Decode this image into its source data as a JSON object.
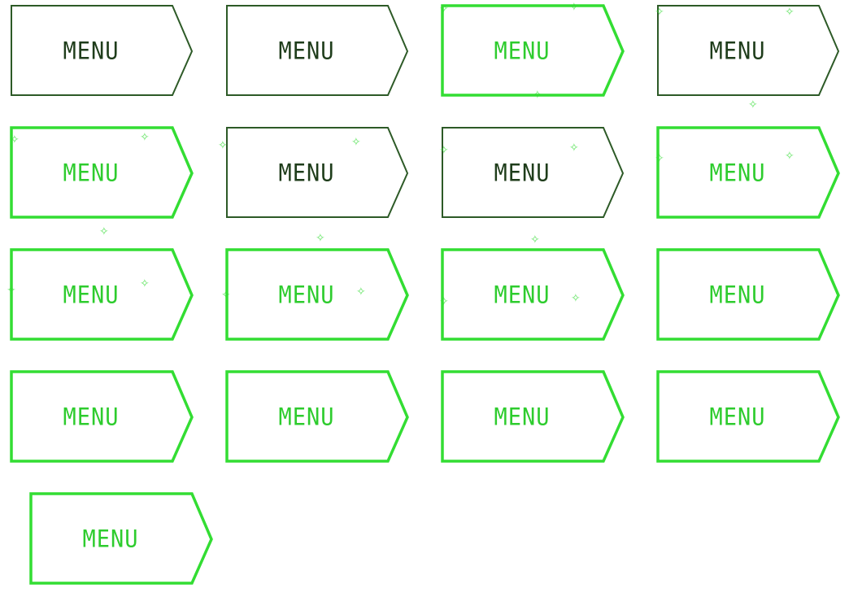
{
  "palette": {
    "dark": "#2d5a27",
    "dark_text": "#1f3d1b",
    "bright": "#33dd33",
    "bright_text": "#2ecc2e"
  },
  "buttons": [
    {
      "label": "MENU",
      "style": "dark"
    },
    {
      "label": "MENU",
      "style": "dark"
    },
    {
      "label": "MENU",
      "style": "bright"
    },
    {
      "label": "MENU",
      "style": "dark"
    },
    {
      "label": "MENU",
      "style": "bright"
    },
    {
      "label": "MENU",
      "style": "dark"
    },
    {
      "label": "MENU",
      "style": "dark"
    },
    {
      "label": "MENU",
      "style": "bright"
    },
    {
      "label": "MENU",
      "style": "bright"
    },
    {
      "label": "MENU",
      "style": "bright"
    },
    {
      "label": "MENU",
      "style": "bright"
    },
    {
      "label": "MENU",
      "style": "bright"
    },
    {
      "label": "MENU",
      "style": "bright"
    },
    {
      "label": "MENU",
      "style": "bright"
    },
    {
      "label": "MENU",
      "style": "bright"
    },
    {
      "label": "MENU",
      "style": "bright"
    },
    {
      "label": "MENU",
      "style": "bright"
    }
  ]
}
